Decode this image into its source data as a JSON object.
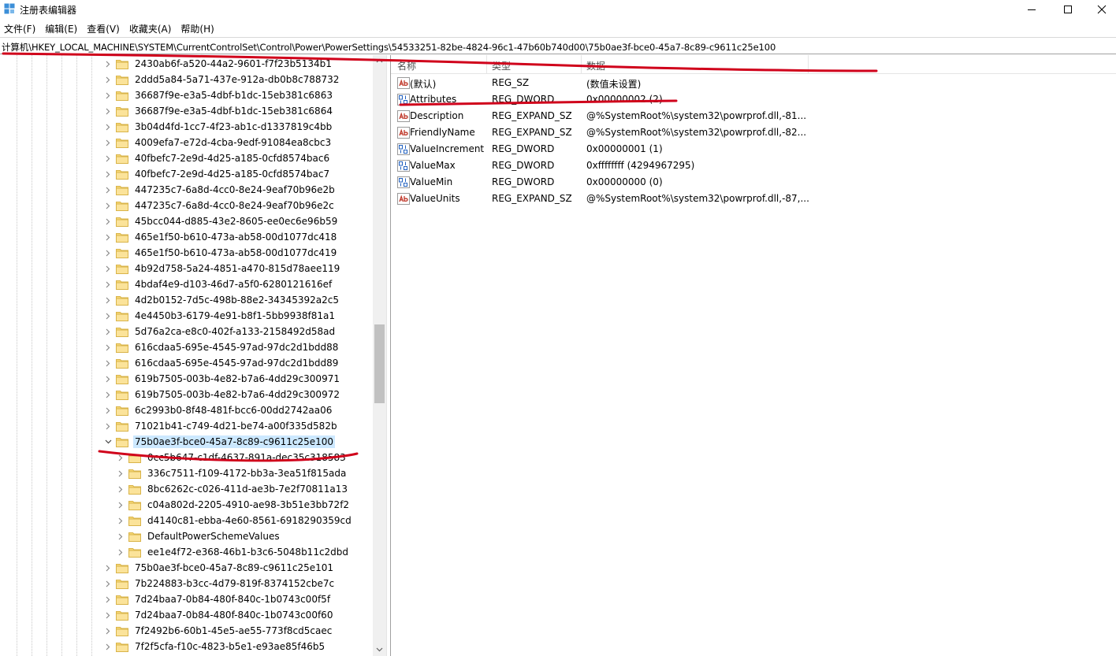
{
  "window": {
    "title": "注册表编辑器",
    "app_icon": "regedit-icon"
  },
  "menu": [
    "文件(F)",
    "编辑(E)",
    "查看(V)",
    "收藏夹(A)",
    "帮助(H)"
  ],
  "address": {
    "path": "计算机\\HKEY_LOCAL_MACHINE\\SYSTEM\\CurrentControlSet\\Control\\Power\\PowerSettings\\54533251-82be-4824-96c1-47b60b740d00\\75b0ae3f-bce0-45a7-8c89-c9611c25e100"
  },
  "tree": {
    "items": [
      {
        "label": "2430ab6f-a520-44a2-9601-f7f23b5134b1",
        "depth": 0
      },
      {
        "label": "2ddd5a84-5a71-437e-912a-db0b8c788732",
        "depth": 0
      },
      {
        "label": "36687f9e-e3a5-4dbf-b1dc-15eb381c6863",
        "depth": 0
      },
      {
        "label": "36687f9e-e3a5-4dbf-b1dc-15eb381c6864",
        "depth": 0
      },
      {
        "label": "3b04d4fd-1cc7-4f23-ab1c-d1337819c4bb",
        "depth": 0
      },
      {
        "label": "4009efa7-e72d-4cba-9edf-91084ea8cbc3",
        "depth": 0
      },
      {
        "label": "40fbefc7-2e9d-4d25-a185-0cfd8574bac6",
        "depth": 0
      },
      {
        "label": "40fbefc7-2e9d-4d25-a185-0cfd8574bac7",
        "depth": 0
      },
      {
        "label": "447235c7-6a8d-4cc0-8e24-9eaf70b96e2b",
        "depth": 0
      },
      {
        "label": "447235c7-6a8d-4cc0-8e24-9eaf70b96e2c",
        "depth": 0
      },
      {
        "label": "45bcc044-d885-43e2-8605-ee0ec6e96b59",
        "depth": 0
      },
      {
        "label": "465e1f50-b610-473a-ab58-00d1077dc418",
        "depth": 0
      },
      {
        "label": "465e1f50-b610-473a-ab58-00d1077dc419",
        "depth": 0
      },
      {
        "label": "4b92d758-5a24-4851-a470-815d78aee119",
        "depth": 0
      },
      {
        "label": "4bdaf4e9-d103-46d7-a5f0-6280121616ef",
        "depth": 0
      },
      {
        "label": "4d2b0152-7d5c-498b-88e2-34345392a2c5",
        "depth": 0
      },
      {
        "label": "4e4450b3-6179-4e91-b8f1-5bb9938f81a1",
        "depth": 0
      },
      {
        "label": "5d76a2ca-e8c0-402f-a133-2158492d58ad",
        "depth": 0
      },
      {
        "label": "616cdaa5-695e-4545-97ad-97dc2d1bdd88",
        "depth": 0
      },
      {
        "label": "616cdaa5-695e-4545-97ad-97dc2d1bdd89",
        "depth": 0
      },
      {
        "label": "619b7505-003b-4e82-b7a6-4dd29c300971",
        "depth": 0
      },
      {
        "label": "619b7505-003b-4e82-b7a6-4dd29c300972",
        "depth": 0
      },
      {
        "label": "6c2993b0-8f48-481f-bcc6-00dd2742aa06",
        "depth": 0
      },
      {
        "label": "71021b41-c749-4d21-be74-a00f335d582b",
        "depth": 0
      },
      {
        "label": "75b0ae3f-bce0-45a7-8c89-c9611c25e100",
        "depth": 0,
        "expanded": true,
        "selected": true
      },
      {
        "label": "0cc5b647-c1df-4637-891a-dec35c318583",
        "depth": 1
      },
      {
        "label": "336c7511-f109-4172-bb3a-3ea51f815ada",
        "depth": 1
      },
      {
        "label": "8bc6262c-c026-411d-ae3b-7e2f70811a13",
        "depth": 1
      },
      {
        "label": "c04a802d-2205-4910-ae98-3b51e3bb72f2",
        "depth": 1
      },
      {
        "label": "d4140c81-ebba-4e60-8561-6918290359cd",
        "depth": 1
      },
      {
        "label": "DefaultPowerSchemeValues",
        "depth": 1
      },
      {
        "label": "ee1e4f72-e368-46b1-b3c6-5048b11c2dbd",
        "depth": 1
      },
      {
        "label": "75b0ae3f-bce0-45a7-8c89-c9611c25e101",
        "depth": 0
      },
      {
        "label": "7b224883-b3cc-4d79-819f-8374152cbe7c",
        "depth": 0
      },
      {
        "label": "7d24baa7-0b84-480f-840c-1b0743c00f5f",
        "depth": 0
      },
      {
        "label": "7d24baa7-0b84-480f-840c-1b0743c00f60",
        "depth": 0
      },
      {
        "label": "7f2492b6-60b1-45e5-ae55-773f8cd5caec",
        "depth": 0
      },
      {
        "label": "7f2f5cfa-f10c-4823-b5e1-e93ae85f46b5",
        "depth": 0
      }
    ]
  },
  "values": {
    "columns": {
      "name": "名称",
      "type": "类型",
      "data": "数据"
    },
    "rows": [
      {
        "name": "(默认)",
        "type": "REG_SZ",
        "data": "(数值未设置)",
        "icon": "string-value-icon"
      },
      {
        "name": "Attributes",
        "type": "REG_DWORD",
        "data": "0x00000002 (2)",
        "icon": "binary-value-icon"
      },
      {
        "name": "Description",
        "type": "REG_EXPAND_SZ",
        "data": "@%SystemRoot%\\system32\\powrprof.dll,-81...",
        "icon": "string-value-icon"
      },
      {
        "name": "FriendlyName",
        "type": "REG_EXPAND_SZ",
        "data": "@%SystemRoot%\\system32\\powrprof.dll,-82...",
        "icon": "string-value-icon"
      },
      {
        "name": "ValueIncrement",
        "type": "REG_DWORD",
        "data": "0x00000001 (1)",
        "icon": "binary-value-icon"
      },
      {
        "name": "ValueMax",
        "type": "REG_DWORD",
        "data": "0xffffffff (4294967295)",
        "icon": "binary-value-icon"
      },
      {
        "name": "ValueMin",
        "type": "REG_DWORD",
        "data": "0x00000000 (0)",
        "icon": "binary-value-icon"
      },
      {
        "name": "ValueUnits",
        "type": "REG_EXPAND_SZ",
        "data": "@%SystemRoot%\\system32\\powrprof.dll,-87,...",
        "icon": "string-value-icon"
      }
    ]
  },
  "colors": {
    "selection": "#cce8ff",
    "folder": "#f6d776",
    "annotation": "#d0021b"
  }
}
